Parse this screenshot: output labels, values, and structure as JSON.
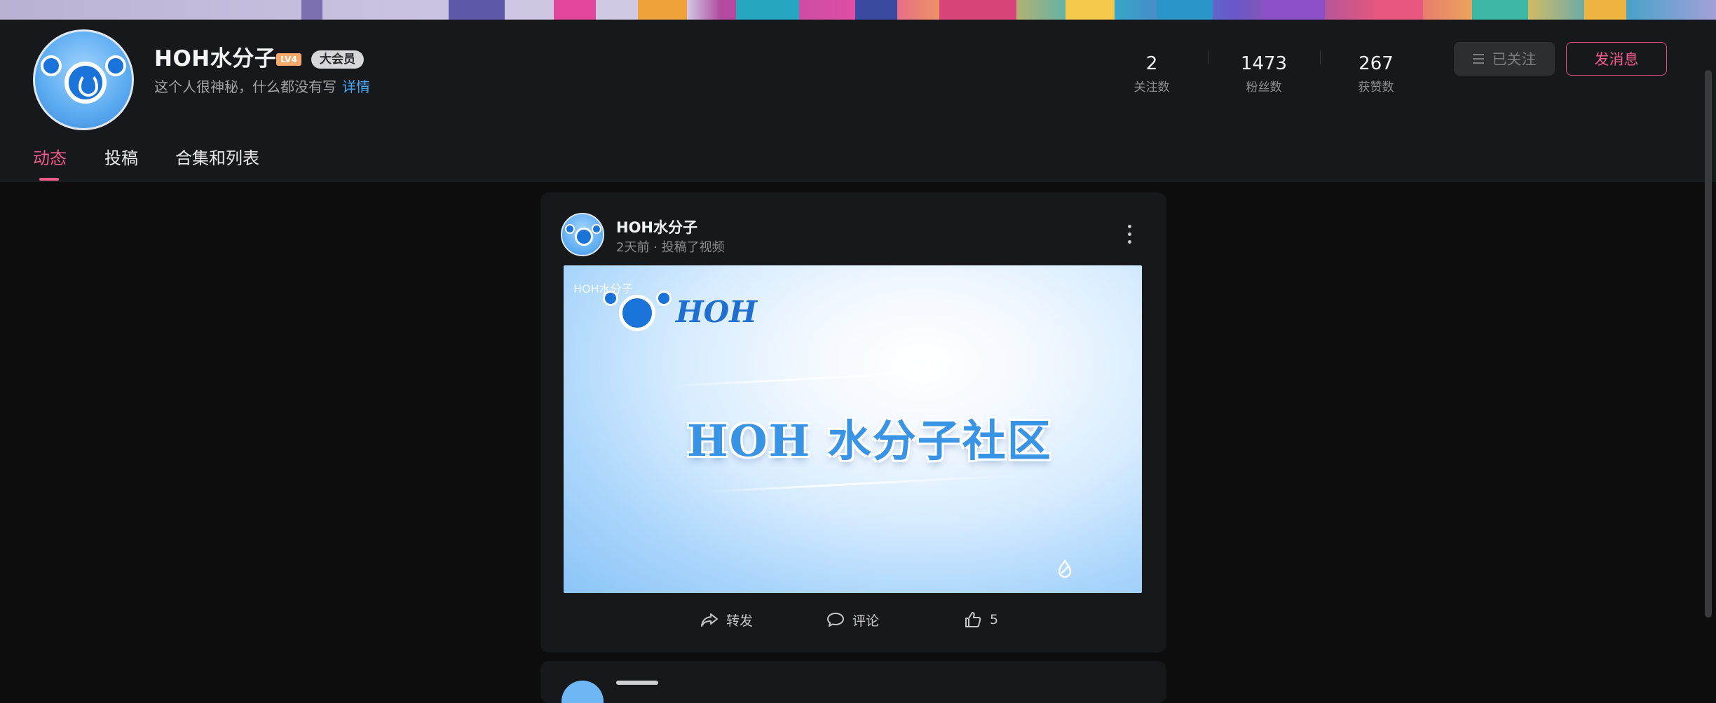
{
  "profile": {
    "username": "HOH水分子",
    "level": "LV4",
    "vip_badge": "大会员",
    "bio": "这个人很神秘，什么都没有写",
    "bio_more": "详情"
  },
  "stats": [
    {
      "value": "2",
      "label": "关注数"
    },
    {
      "value": "1473",
      "label": "粉丝数"
    },
    {
      "value": "267",
      "label": "获赞数"
    }
  ],
  "buttons": {
    "follow": "已关注",
    "message": "发消息"
  },
  "tabs": [
    {
      "label": "动态",
      "active": true
    },
    {
      "label": "投稿",
      "active": false
    },
    {
      "label": "合集和列表",
      "active": false
    }
  ],
  "post": {
    "author": "HOH水分子",
    "meta": "2天前 · 投稿了视频",
    "video": {
      "watermark": "HOH水分子",
      "logo_text": "HOH",
      "title": "HOH 水分子社区"
    },
    "actions": {
      "share": "转发",
      "comment": "评论",
      "like_count": "5"
    }
  },
  "colors": {
    "accent": "#f05b8a",
    "link": "#4aa8ff",
    "background": "#0d0d0e",
    "panel": "#17181b"
  }
}
